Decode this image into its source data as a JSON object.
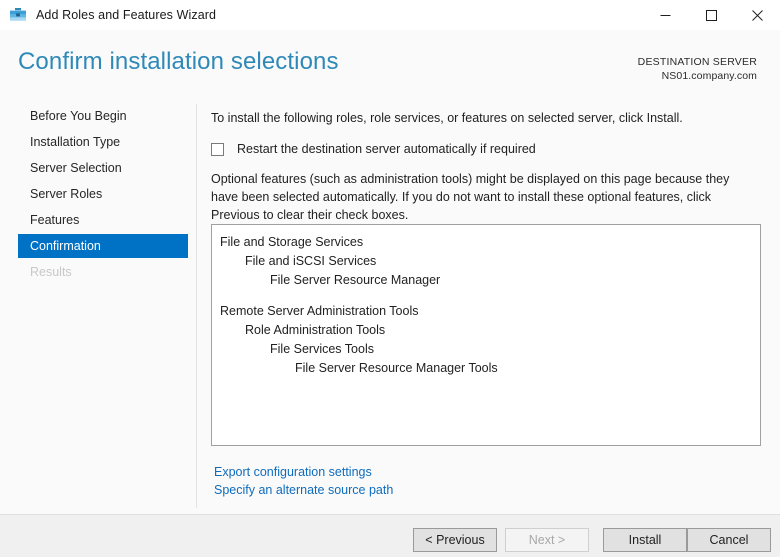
{
  "window": {
    "title": "Add Roles and Features Wizard",
    "icon": "toolbox-icon",
    "controls": {
      "minimize": "—",
      "maximize": "□",
      "close": "✕"
    }
  },
  "header": {
    "page_title": "Confirm installation selections",
    "destination_label": "DESTINATION SERVER",
    "destination_server": "NS01.company.com",
    "accent_color": "#2f89b8"
  },
  "sidebar": {
    "items": [
      {
        "label": "Before You Begin",
        "state": "normal"
      },
      {
        "label": "Installation Type",
        "state": "normal"
      },
      {
        "label": "Server Selection",
        "state": "normal"
      },
      {
        "label": "Server Roles",
        "state": "normal"
      },
      {
        "label": "Features",
        "state": "normal"
      },
      {
        "label": "Confirmation",
        "state": "selected"
      },
      {
        "label": "Results",
        "state": "disabled"
      }
    ],
    "selected_color": "#0072c6"
  },
  "main": {
    "intro_text": "To install the following roles, role services, or features on selected server, click Install.",
    "restart_checkbox": {
      "label": "Restart the destination server automatically if required",
      "checked": false
    },
    "optional_text": "Optional features (such as administration tools) might be displayed on this page because they have been selected automatically. If you do not want to install these optional features, click Previous to clear their check boxes.",
    "feature_tree": [
      {
        "label": "File and Storage Services",
        "level": 0
      },
      {
        "label": "File and iSCSI Services",
        "level": 1
      },
      {
        "label": "File Server Resource Manager",
        "level": 2
      },
      {
        "label": "",
        "level": -1
      },
      {
        "label": "Remote Server Administration Tools",
        "level": 0
      },
      {
        "label": "Role Administration Tools",
        "level": 1
      },
      {
        "label": "File Services Tools",
        "level": 2
      },
      {
        "label": "File Server Resource Manager Tools",
        "level": 3
      }
    ],
    "links": [
      "Export configuration settings",
      "Specify an alternate source path"
    ],
    "link_color": "#0f6cbd"
  },
  "footer": {
    "buttons": [
      {
        "label": "< Previous",
        "enabled": true
      },
      {
        "label": "Next >",
        "enabled": false
      },
      {
        "label": "Install",
        "enabled": true
      },
      {
        "label": "Cancel",
        "enabled": true
      }
    ]
  }
}
